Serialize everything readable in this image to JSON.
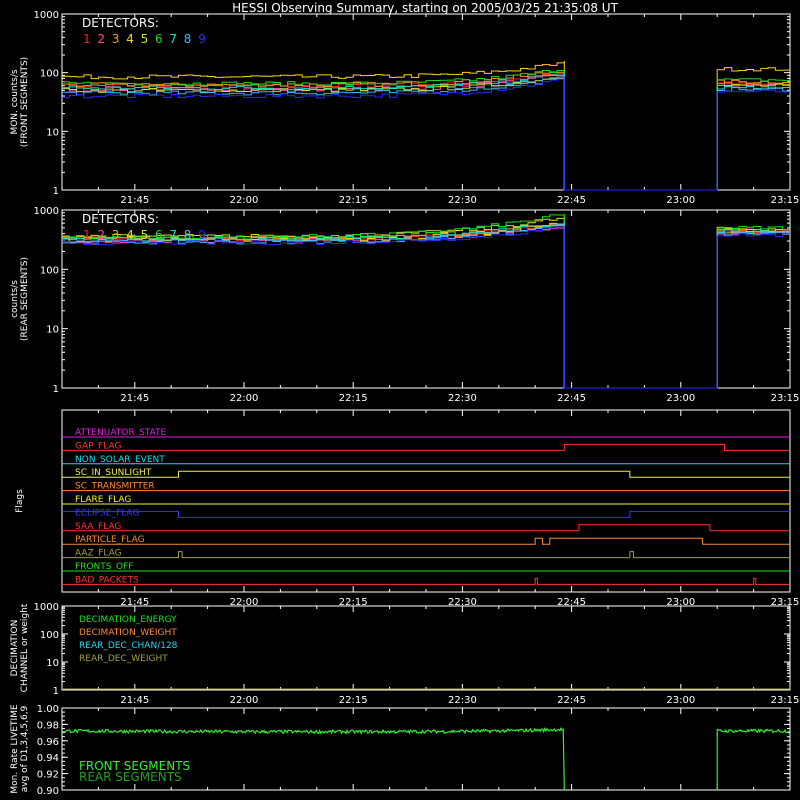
{
  "title": "HESSI Observing Summary, starting on 2005/03/25 21:35:08 UT",
  "colors": {
    "background": "#000000",
    "axis": "#ffffff",
    "detectors": [
      "#ff2222",
      "#ff44aa",
      "#ff9a1a",
      "#ffd21a",
      "#c8e628",
      "#18e018",
      "#18e0c8",
      "#40b8ff",
      "#2a2aff"
    ]
  },
  "time_axis": {
    "start": "21:35",
    "end": "23:15",
    "tick_labels": [
      "21:45",
      "22:00",
      "22:15",
      "22:30",
      "22:45",
      "23:00",
      "23:15"
    ]
  },
  "detector_legend": {
    "title": "DETECTORS:",
    "numbers": [
      "1",
      "2",
      "3",
      "4",
      "5",
      "6",
      "7",
      "8",
      "9"
    ]
  },
  "chart_data": [
    {
      "type": "line",
      "ylabel": [
        "MON. counts/s",
        "(FRONT SEGMENTS)"
      ],
      "yscale": "log",
      "ylim": [
        1,
        1000
      ],
      "y_tick_labels": [
        "1",
        "10",
        "100",
        "1000"
      ],
      "data_gap": [
        "22:44",
        "23:05"
      ],
      "series_end_values": [
        {
          "detector": "1",
          "start": 60,
          "before_gap": 100,
          "after_gap": 65
        },
        {
          "detector": "2",
          "start": 52,
          "before_gap": 95,
          "after_gap": 62
        },
        {
          "detector": "3",
          "start": 62,
          "before_gap": 115,
          "after_gap": 70
        },
        {
          "detector": "4",
          "start": 85,
          "before_gap": 150,
          "after_gap": 115
        },
        {
          "detector": "5",
          "start": 50,
          "before_gap": 90,
          "after_gap": 60
        },
        {
          "detector": "6",
          "start": 65,
          "before_gap": 120,
          "after_gap": 75
        },
        {
          "detector": "7",
          "start": 55,
          "before_gap": 100,
          "after_gap": 55
        },
        {
          "detector": "8",
          "start": 45,
          "before_gap": 85,
          "after_gap": 52
        },
        {
          "detector": "9",
          "start": 40,
          "before_gap": 80,
          "after_gap": 48
        }
      ]
    },
    {
      "type": "line",
      "ylabel": [
        "counts/s",
        "(REAR SEGMENTS)"
      ],
      "yscale": "log",
      "ylim": [
        1,
        1000
      ],
      "y_tick_labels": [
        "1",
        "10",
        "100",
        "1000"
      ],
      "data_gap": [
        "22:44",
        "23:05"
      ],
      "series_end_values": [
        {
          "detector": "1",
          "start": 330,
          "before_gap": 600,
          "after_gap": 430
        },
        {
          "detector": "2",
          "start": 300,
          "before_gap": 560,
          "after_gap": 410
        },
        {
          "detector": "3",
          "start": 340,
          "before_gap": 650,
          "after_gap": 450
        },
        {
          "detector": "4",
          "start": 310,
          "before_gap": 600,
          "after_gap": 420
        },
        {
          "detector": "5",
          "start": 360,
          "before_gap": 750,
          "after_gap": 480
        },
        {
          "detector": "6",
          "start": 350,
          "before_gap": 850,
          "after_gap": 500
        },
        {
          "detector": "7",
          "start": 320,
          "before_gap": 620,
          "after_gap": 440
        },
        {
          "detector": "8",
          "start": 290,
          "before_gap": 560,
          "after_gap": 400
        },
        {
          "detector": "9",
          "start": 280,
          "before_gap": 520,
          "after_gap": 380
        }
      ]
    },
    {
      "type": "line",
      "ylabel": [
        "Flags"
      ],
      "flags": [
        {
          "name": "ATTENUATOR_STATE",
          "color": "#e020e0",
          "on": []
        },
        {
          "name": "GAP_FLAG",
          "color": "#ff3333",
          "on": [
            [
              "22:44",
              "23:06"
            ]
          ]
        },
        {
          "name": "NON_SOLAR_EVENT",
          "color": "#20d8f0",
          "on": []
        },
        {
          "name": "SC_IN_SUNLIGHT",
          "color": "#f0f040",
          "on": [
            [
              "21:35",
              "21:51"
            ],
            [
              "22:53",
              "23:15"
            ]
          ],
          "on_means": "low"
        },
        {
          "name": "SC_TRANSMITTER",
          "color": "#ff8833",
          "on": []
        },
        {
          "name": "FLARE_FLAG",
          "color": "#f0f040",
          "on": []
        },
        {
          "name": "ECLIPSE_FLAG",
          "color": "#3333ff",
          "on": [
            [
              "21:35",
              "21:51"
            ],
            [
              "22:53",
              "23:15"
            ]
          ]
        },
        {
          "name": "SAA_FLAG",
          "color": "#ff3333",
          "on": [
            [
              "22:46",
              "23:04"
            ]
          ]
        },
        {
          "name": "PARTICLE_FLAG",
          "color": "#ff8833",
          "on": [
            [
              "22:40",
              "22:41"
            ],
            [
              "22:42",
              "23:03"
            ]
          ]
        },
        {
          "name": "AAZ_FLAG",
          "color": "#a0a040",
          "on": [
            [
              "21:51",
              "21:51.5"
            ],
            [
              "22:53",
              "22:53.5"
            ]
          ]
        },
        {
          "name": "FRONTS_OFF",
          "color": "#20e020",
          "on": []
        },
        {
          "name": "BAD_PACKETS",
          "color": "#ff3333",
          "on": [
            [
              "22:40",
              "22:40.3"
            ],
            [
              "23:10",
              "23:10.3"
            ]
          ]
        }
      ]
    },
    {
      "type": "line",
      "ylabel": [
        "DECIMATION",
        "CHANNEL or weight"
      ],
      "yscale": "log",
      "ylim": [
        1,
        1000
      ],
      "y_tick_labels": [
        "1",
        "10",
        "100",
        "1000"
      ],
      "legend": [
        {
          "name": "DECIMATION_ENERGY",
          "color": "#20e020"
        },
        {
          "name": "DECIMATION_WEIGHT",
          "color": "#ff8833"
        },
        {
          "name": "REAR_DEC_CHAN/128",
          "color": "#20d8f0"
        },
        {
          "name": "REAR_DEC_WEIGHT",
          "color": "#a0a040"
        }
      ],
      "series": [
        {
          "name": "REAR_DEC_WEIGHT",
          "values": [
            [
              "21:35",
              1
            ],
            [
              "23:15",
              1
            ]
          ]
        }
      ]
    },
    {
      "type": "line",
      "ylabel": [
        "Mon. Rate LIVETIME",
        "avg of D1,3,4,5,6,9"
      ],
      "ylim": [
        0.9,
        1.0
      ],
      "y_tick_labels": [
        "0.90",
        "0.92",
        "0.94",
        "0.96",
        "0.98",
        "1.00"
      ],
      "data_gap": [
        "22:44",
        "23:05"
      ],
      "series": [
        {
          "name": "FRONT SEGMENTS",
          "color": "#30f030",
          "start": 0.972,
          "mid": 0.971,
          "before_gap": 0.974,
          "after_gap": 0.972
        },
        {
          "name": "REAR SEGMENTS",
          "color": "#20a020"
        }
      ]
    }
  ]
}
